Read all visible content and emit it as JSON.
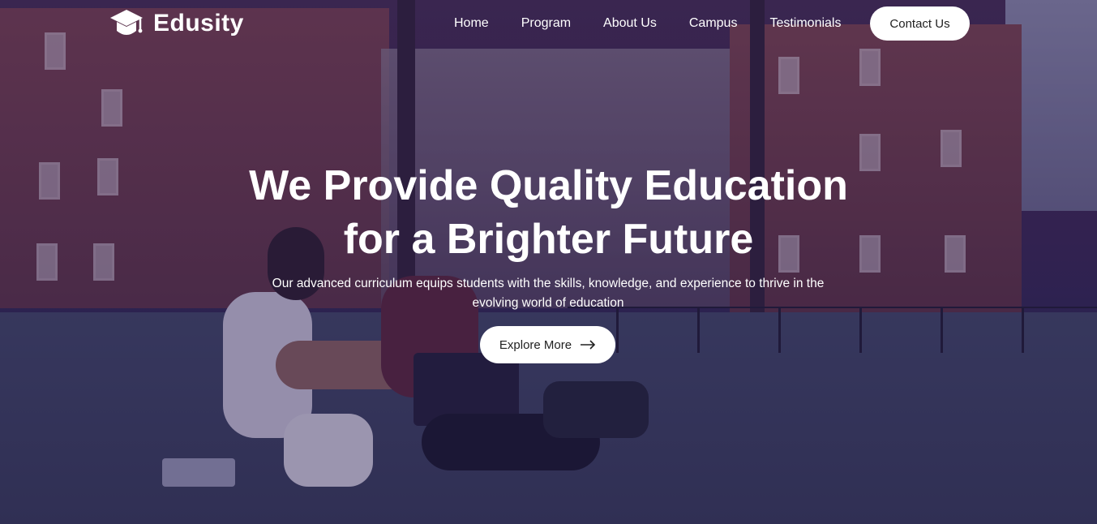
{
  "brand": {
    "name": "Edusity",
    "logo_icon": "graduation-cap-icon"
  },
  "nav": {
    "items": [
      {
        "label": "Home"
      },
      {
        "label": "Program"
      },
      {
        "label": "About Us"
      },
      {
        "label": "Campus"
      },
      {
        "label": "Testimonials"
      }
    ],
    "contact_label": "Contact Us"
  },
  "hero": {
    "title_line1": "We Provide Quality Education",
    "title_line2": "for a Brighter Future",
    "subtitle": "Our advanced curriculum equips students with the skills, knowledge, and experience to thrive in the evolving world of education",
    "cta_label": "Explore More",
    "cta_icon": "arrow-right-icon",
    "background_image": "students-on-campus-lawn",
    "overlay_color": "#281c5a"
  },
  "colors": {
    "button_bg": "#ffffff",
    "button_text": "#212121",
    "text": "#ffffff"
  }
}
